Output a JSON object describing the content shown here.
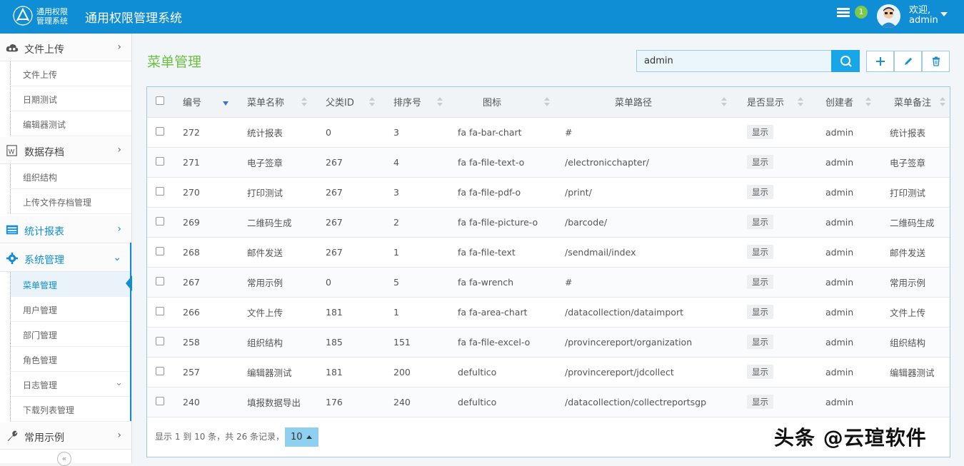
{
  "header": {
    "logo_text_line1": "通用权限",
    "logo_text_line2": "管理系统",
    "app_title": "通用权限管理系统",
    "notification_count": "1",
    "welcome_line1": "欢迎,",
    "welcome_line2": "admin"
  },
  "sidebar": {
    "groups": [
      {
        "label": "文件上传",
        "items": [
          "文件上传",
          "日期测试",
          "编辑器测试"
        ]
      },
      {
        "label": "数据存档",
        "items": [
          "组织结构",
          "上传文件存档管理"
        ]
      },
      {
        "label": "统计报表",
        "items": []
      },
      {
        "label": "系统管理",
        "items": [
          "菜单管理",
          "用户管理",
          "部门管理",
          "角色管理",
          "日志管理",
          "下载列表管理"
        ]
      },
      {
        "label": "常用示例",
        "items": []
      }
    ],
    "active_item": "菜单管理",
    "collapse_glyph": "«"
  },
  "main": {
    "page_title": "菜单管理",
    "search_value": "admin",
    "columns": [
      "编号",
      "菜单名称",
      "父类ID",
      "排序号",
      "图标",
      "菜单路径",
      "是否显示",
      "创建者",
      "菜单备注"
    ],
    "rows": [
      {
        "id": "272",
        "name": "统计报表",
        "parent": "0",
        "order": "3",
        "icon": "fa fa-bar-chart",
        "path": "#",
        "show": "显示",
        "creator": "admin",
        "note": "统计报表"
      },
      {
        "id": "271",
        "name": "电子签章",
        "parent": "267",
        "order": "4",
        "icon": "fa fa-file-text-o",
        "path": "/electronicchapter/",
        "show": "显示",
        "creator": "admin",
        "note": "电子签章"
      },
      {
        "id": "270",
        "name": "打印测试",
        "parent": "267",
        "order": "3",
        "icon": "fa fa-file-pdf-o",
        "path": "/print/",
        "show": "显示",
        "creator": "admin",
        "note": "打印测试"
      },
      {
        "id": "269",
        "name": "二维码生成",
        "parent": "267",
        "order": "2",
        "icon": "fa fa-file-picture-o",
        "path": "/barcode/",
        "show": "显示",
        "creator": "admin",
        "note": "二维码生成"
      },
      {
        "id": "268",
        "name": "邮件发送",
        "parent": "267",
        "order": "1",
        "icon": "fa fa-file-text",
        "path": "/sendmail/index",
        "show": "显示",
        "creator": "admin",
        "note": "邮件发送"
      },
      {
        "id": "267",
        "name": "常用示例",
        "parent": "0",
        "order": "5",
        "icon": "fa fa-wrench",
        "path": "#",
        "show": "显示",
        "creator": "admin",
        "note": "常用示例"
      },
      {
        "id": "266",
        "name": "文件上传",
        "parent": "181",
        "order": "1",
        "icon": "fa fa-area-chart",
        "path": "/datacollection/dataimport",
        "show": "显示",
        "creator": "admin",
        "note": "文件上传"
      },
      {
        "id": "258",
        "name": "组织结构",
        "parent": "185",
        "order": "151",
        "icon": "fa fa-file-excel-o",
        "path": "/provincereport/organization",
        "show": "显示",
        "creator": "admin",
        "note": "组织结构"
      },
      {
        "id": "257",
        "name": "编辑器测试",
        "parent": "181",
        "order": "200",
        "icon": "defultico",
        "path": "/provincereport/jdcollect",
        "show": "显示",
        "creator": "admin",
        "note": "编辑器测试"
      },
      {
        "id": "240",
        "name": "填报数据导出",
        "parent": "176",
        "order": "240",
        "icon": "defultico",
        "path": "/datacollection/collectreportsgp",
        "show": "显示",
        "creator": "admin",
        "note": ""
      }
    ],
    "pager_text": "显示 1 到 10 条，共 26 条记录，",
    "page_size": "10"
  },
  "watermark": "头条 @云瑄软件",
  "colors": {
    "header_bg": "#0f8ed6",
    "accent_green": "#6abf3f",
    "search_btn": "#18a6e6"
  }
}
